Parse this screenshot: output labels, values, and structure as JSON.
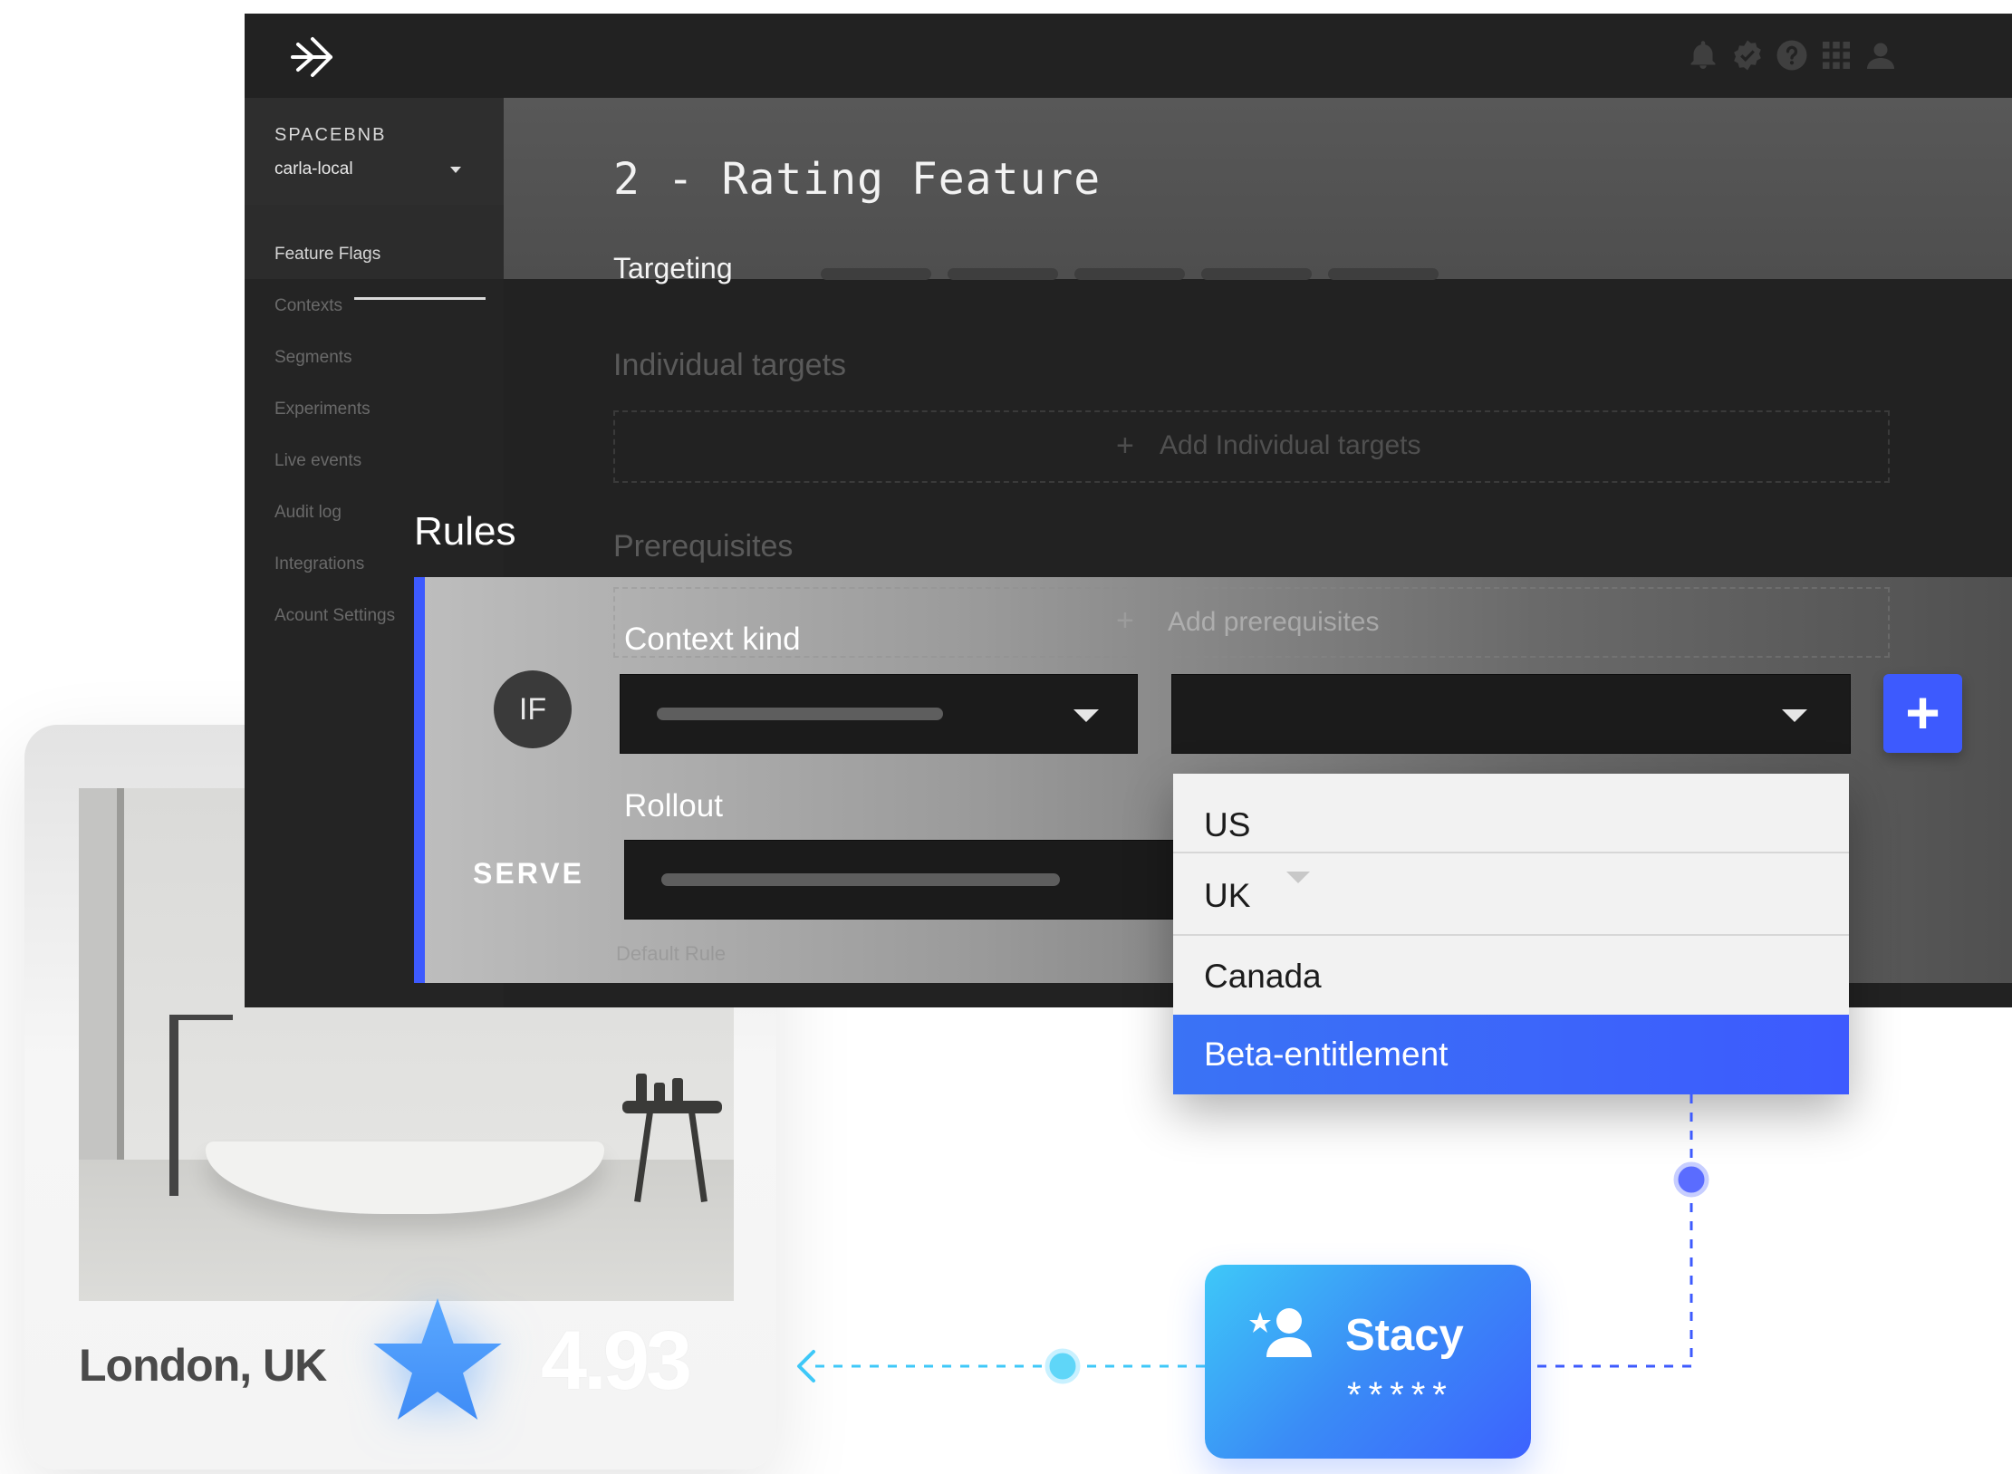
{
  "app": {
    "project": "SPACEBNB",
    "environment": "carla-local",
    "flag_title": "2 - Rating Feature",
    "active_tab": "Targeting",
    "sections": {
      "individual_targets": "Individual targets",
      "add_individual_targets": "Add Individual targets",
      "prerequisites": "Prerequisites",
      "add_prerequisites": "Add prerequisites",
      "rules": "Rules",
      "default_rule": "Default Rule"
    },
    "rule": {
      "if_label": "IF",
      "serve_label": "SERVE",
      "context_kind_label": "Context kind",
      "rollout_label": "Rollout",
      "add_symbol": "+"
    },
    "topbar_icons": [
      "bell-icon",
      "verified-badge-icon",
      "help-icon",
      "apps-grid-icon",
      "user-icon"
    ]
  },
  "sidebar": {
    "items": [
      {
        "label": "Feature Flags",
        "active": true
      },
      {
        "label": "Contexts",
        "active": false
      },
      {
        "label": "Segments",
        "active": false
      },
      {
        "label": "Experiments",
        "active": false
      },
      {
        "label": "Live events",
        "active": false
      },
      {
        "label": "Audit log",
        "active": false
      },
      {
        "label": "Integrations",
        "active": false
      },
      {
        "label": "Acount Settings",
        "active": false
      }
    ]
  },
  "dropdown": {
    "options": [
      "US",
      "UK",
      "Canada",
      "Beta-entitlement"
    ],
    "selected": "Beta-entitlement"
  },
  "listing": {
    "location": "London, UK",
    "rating": "4.93"
  },
  "user": {
    "name": "Stacy",
    "stars": "*****"
  },
  "colors": {
    "accent_blue": "#3d5afe",
    "cyan": "#3ec8f8",
    "dark_bg": "#222222"
  }
}
